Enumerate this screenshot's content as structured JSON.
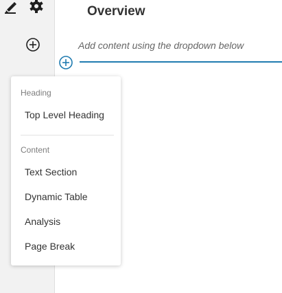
{
  "sidebar": {
    "icons": [
      "pen-icon",
      "gear-icon",
      "add-circle-icon"
    ]
  },
  "main": {
    "title": "Overview",
    "placeholder": "Add content using the dropdown below"
  },
  "dropdown": {
    "heading_group_label": "Heading",
    "heading_items": [
      {
        "label": "Top Level Heading"
      }
    ],
    "content_group_label": "Content",
    "content_items": [
      {
        "label": "Text Section"
      },
      {
        "label": "Dynamic Table"
      },
      {
        "label": "Analysis"
      },
      {
        "label": "Page Break"
      }
    ]
  },
  "colors": {
    "accent": "#1f7bb0",
    "sidebar_bg": "#f2f2f2",
    "text": "#333333",
    "muted": "#7d7d7d"
  }
}
